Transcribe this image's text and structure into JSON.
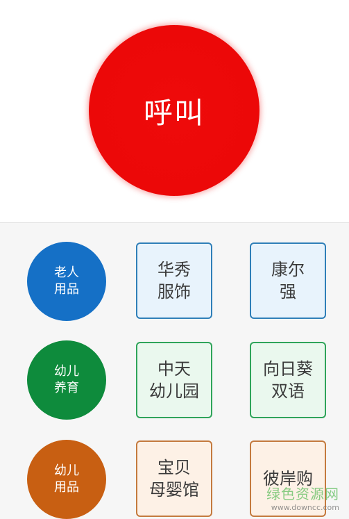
{
  "call_button": {
    "label": "呼叫",
    "color": "#ec0808"
  },
  "rows": [
    {
      "category": {
        "label": "老人\n用品",
        "color": "#1570c6"
      },
      "items": [
        {
          "label": "华秀\n服饰"
        },
        {
          "label": "康尔\n强"
        }
      ],
      "border_color": "#2f7fb8"
    },
    {
      "category": {
        "label": "幼儿\n养育",
        "color": "#0e8b3c"
      },
      "items": [
        {
          "label": "中天\n幼儿园"
        },
        {
          "label": "向日葵\n双语"
        }
      ],
      "border_color": "#2fa45a"
    },
    {
      "category": {
        "label": "幼儿\n用品",
        "color": "#c85f12"
      },
      "items": [
        {
          "label": "宝贝\n母婴馆"
        },
        {
          "label": "彼岸购"
        }
      ],
      "border_color": "#c47a3e"
    }
  ],
  "watermark": {
    "text": "绿色资源网",
    "url": "www.downcc.com"
  }
}
